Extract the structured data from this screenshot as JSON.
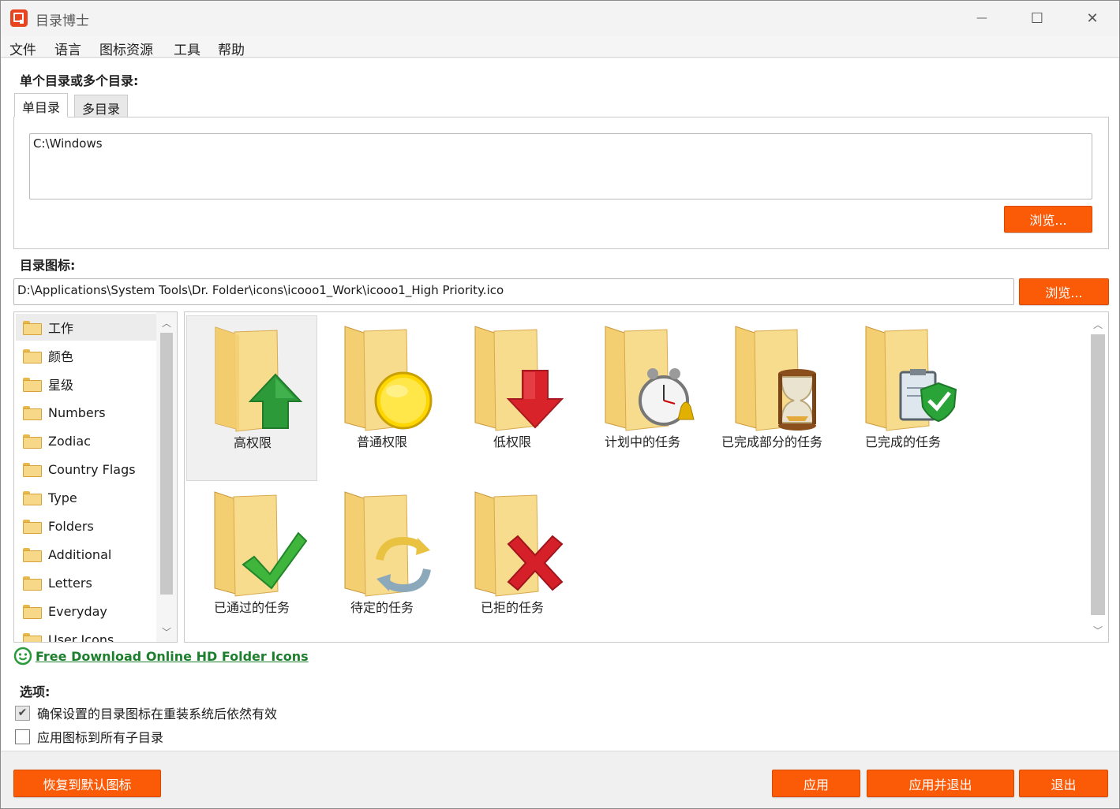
{
  "window": {
    "title": "目录博士",
    "minimize_glyph": "—",
    "maximize_glyph": "☐",
    "close_glyph": "✕"
  },
  "menu": [
    "文件",
    "语言",
    "图标资源",
    "工具",
    "帮助"
  ],
  "directory_section": {
    "label": "单个目录或多个目录:",
    "tabs": [
      "单目录",
      "多目录"
    ],
    "active_tab": "单目录",
    "path_value": "C:\\Windows",
    "browse_label": "浏览..."
  },
  "icon_section": {
    "label": "目录图标:",
    "path_value": "D:\\Applications\\System Tools\\Dr. Folder\\icons\\icooo1_Work\\icooo1_High Priority.ico",
    "browse_label": "浏览..."
  },
  "categories": [
    {
      "label": "工作",
      "selected": true
    },
    {
      "label": "颜色"
    },
    {
      "label": "星级"
    },
    {
      "label": "Numbers"
    },
    {
      "label": "Zodiac"
    },
    {
      "label": "Country Flags"
    },
    {
      "label": "Type"
    },
    {
      "label": "Folders"
    },
    {
      "label": "Additional"
    },
    {
      "label": "Letters"
    },
    {
      "label": "Everyday"
    },
    {
      "label": "User Icons"
    }
  ],
  "icons": [
    {
      "label": "高权限",
      "badge": "green-up-arrow",
      "selected": true
    },
    {
      "label": "普通权限",
      "badge": "yellow-circle"
    },
    {
      "label": "低权限",
      "badge": "red-down-arrow"
    },
    {
      "label": "计划中的任务",
      "badge": "alarm-clock"
    },
    {
      "label": "已完成部分的任务",
      "badge": "hourglass"
    },
    {
      "label": "已完成的任务",
      "badge": "clipboard-shield"
    },
    {
      "label": "已通过的任务",
      "badge": "green-check"
    },
    {
      "label": "待定的任务",
      "badge": "refresh-arrows"
    },
    {
      "label": "已拒的任务",
      "badge": "red-x"
    }
  ],
  "download_link": "Free Download Online HD Folder Icons",
  "options": {
    "label": "选项:",
    "items": [
      {
        "label": "确保设置的目录图标在重装系统后依然有效",
        "checked": true
      },
      {
        "label": "应用图标到所有子目录",
        "checked": false
      }
    ]
  },
  "buttons": {
    "restore": "恢复到默认图标",
    "apply": "应用",
    "apply_exit": "应用并退出",
    "exit": "退出"
  },
  "colors": {
    "accent": "#fb5a07",
    "link": "#1d7f2e"
  }
}
